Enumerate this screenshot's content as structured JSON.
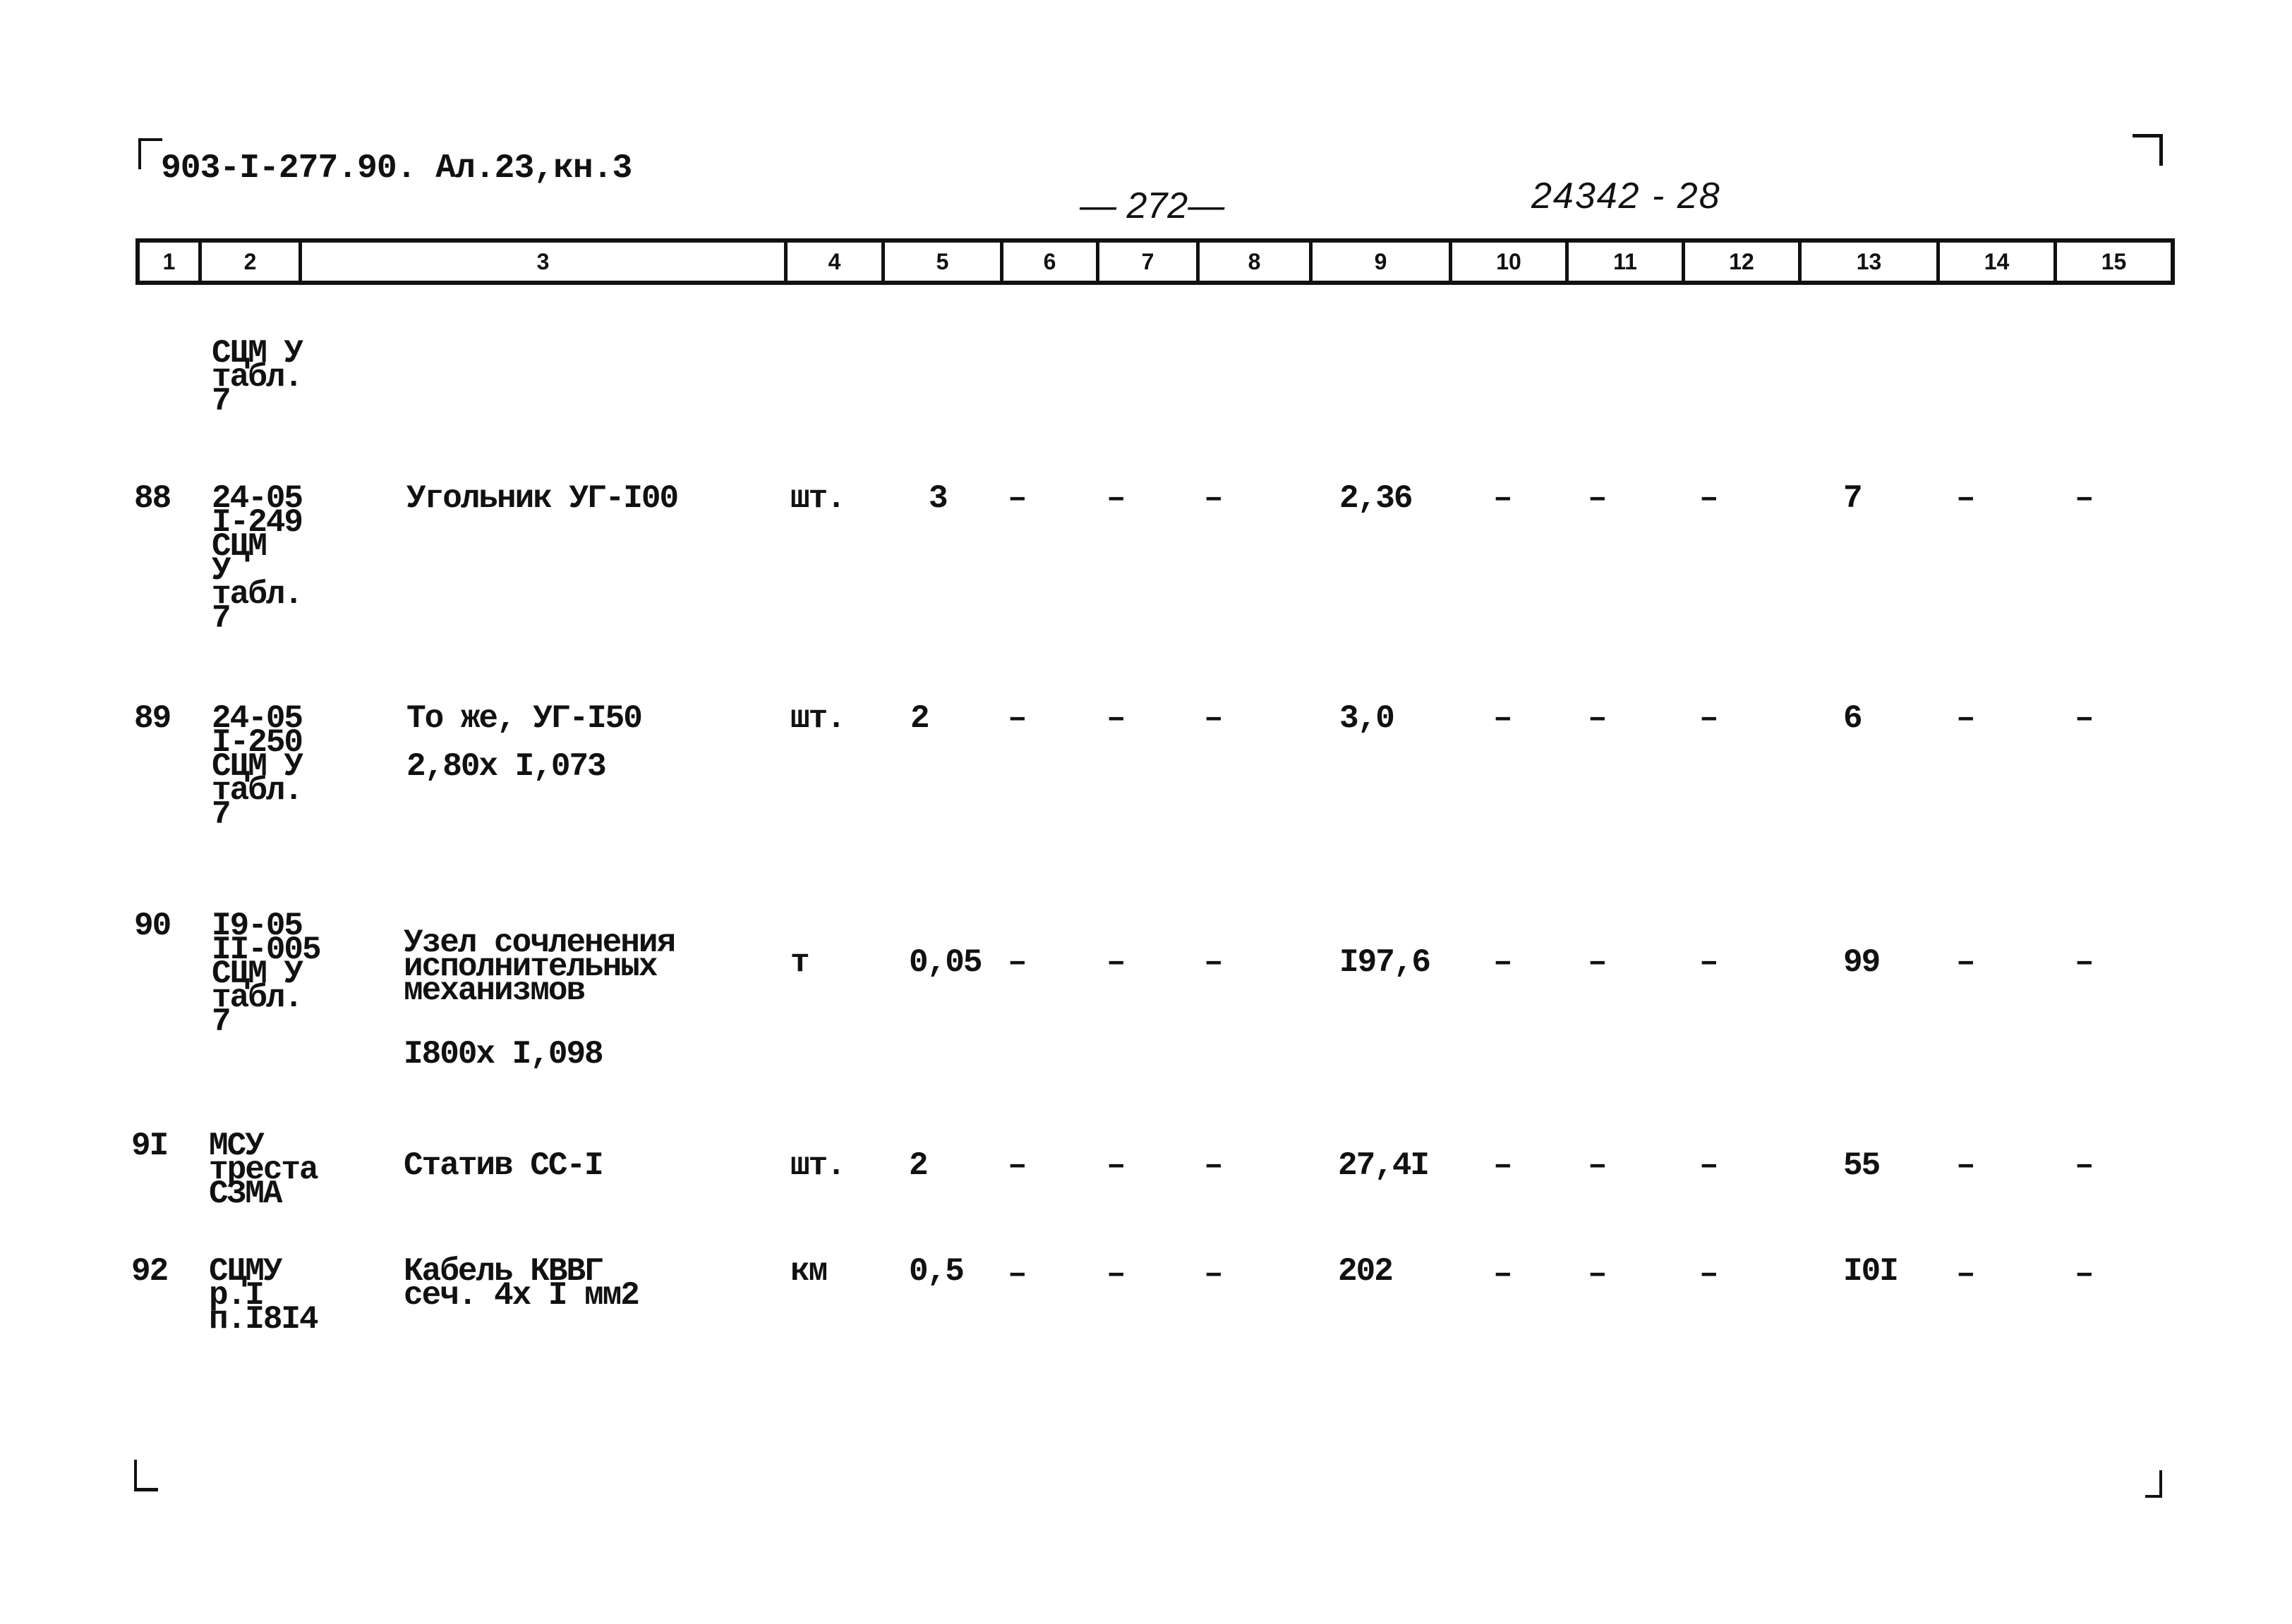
{
  "header": {
    "doc_code": "903-I-277.90. Ал.23,кн.3",
    "page_number": "— 272—",
    "sheet_id": "24342 - 28"
  },
  "columns": [
    "1",
    "2",
    "3",
    "4",
    "5",
    "6",
    "7",
    "8",
    "9",
    "10",
    "11",
    "12",
    "13",
    "14",
    "15"
  ],
  "continuation": {
    "ref": "СЦМ У\nтабл.\n7"
  },
  "rows": [
    {
      "no": "88",
      "ref": "24-05\nI-249\nСЦМ\nУ\nтабл.\n7",
      "desc": "Угольник УГ-I00",
      "unit": "шт.",
      "qty": "3",
      "c6": "–",
      "c7": "–",
      "c8": "–",
      "c9": "2,36",
      "c10": "–",
      "c11": "–",
      "c12": "–",
      "c13": "7",
      "c14": "–",
      "c15": "–"
    },
    {
      "no": "89",
      "ref": "24-05\nI-250\nСЦМ У\nтабл.\n7",
      "desc": "То же, УГ-I50",
      "desc2": "2,80х I,073",
      "unit": "шт.",
      "qty": "2",
      "c6": "–",
      "c7": "–",
      "c8": "–",
      "c9": "3,0",
      "c10": "–",
      "c11": "–",
      "c12": "–",
      "c13": "6",
      "c14": "–",
      "c15": "–"
    },
    {
      "no": "90",
      "ref": "I9-05\nII-005\nСЦМ У\nтабл.\n7",
      "desc": "Узел сочленения\nисполнительных\nмеханизмов",
      "desc2": "I800х I,098",
      "unit": "т",
      "qty": "0,05",
      "c6": "–",
      "c7": "–",
      "c8": "–",
      "c9": "I97,6",
      "c10": "–",
      "c11": "–",
      "c12": "–",
      "c13": "99",
      "c14": "–",
      "c15": "–"
    },
    {
      "no": "9I",
      "ref": "МСУ\nтреста\nСЗМА",
      "desc": "Статив СС-I",
      "unit": "шт.",
      "qty": "2",
      "c6": "–",
      "c7": "–",
      "c8": "–",
      "c9": "27,4I",
      "c10": "–",
      "c11": "–",
      "c12": "–",
      "c13": "55",
      "c14": "–",
      "c15": "–"
    },
    {
      "no": "92",
      "ref": "СЦМУ\nр.I\nп.I8I4",
      "desc": "Кабель КВВГ\nсеч. 4х I мм2",
      "unit": "км",
      "qty": "0,5",
      "c6": "–",
      "c7": "–",
      "c8": "–",
      "c9": "202",
      "c10": "–",
      "c11": "–",
      "c12": "–",
      "c13": "I0I",
      "c14": "–",
      "c15": "–"
    }
  ]
}
